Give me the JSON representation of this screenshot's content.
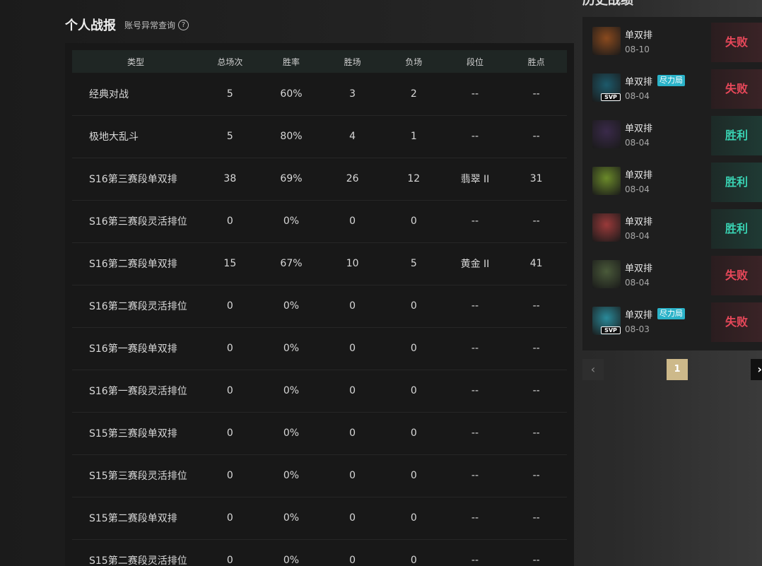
{
  "header": {
    "title": "个人战报",
    "account_query": "账号异常查询",
    "help": "?"
  },
  "table": {
    "columns": [
      "类型",
      "总场次",
      "胜率",
      "胜场",
      "负场",
      "段位",
      "胜点"
    ],
    "rows": [
      [
        "经典对战",
        "5",
        "60%",
        "3",
        "2",
        "--",
        "--"
      ],
      [
        "极地大乱斗",
        "5",
        "80%",
        "4",
        "1",
        "--",
        "--"
      ],
      [
        "S16第三赛段单双排",
        "38",
        "69%",
        "26",
        "12",
        "翡翠 II",
        "31"
      ],
      [
        "S16第三赛段灵活排位",
        "0",
        "0%",
        "0",
        "0",
        "--",
        "--"
      ],
      [
        "S16第二赛段单双排",
        "15",
        "67%",
        "10",
        "5",
        "黄金 II",
        "41"
      ],
      [
        "S16第二赛段灵活排位",
        "0",
        "0%",
        "0",
        "0",
        "--",
        "--"
      ],
      [
        "S16第一赛段单双排",
        "0",
        "0%",
        "0",
        "0",
        "--",
        "--"
      ],
      [
        "S16第一赛段灵活排位",
        "0",
        "0%",
        "0",
        "0",
        "--",
        "--"
      ],
      [
        "S15第三赛段单双排",
        "0",
        "0%",
        "0",
        "0",
        "--",
        "--"
      ],
      [
        "S15第三赛段灵活排位",
        "0",
        "0%",
        "0",
        "0",
        "--",
        "--"
      ],
      [
        "S15第二赛段单双排",
        "0",
        "0%",
        "0",
        "0",
        "--",
        "--"
      ],
      [
        "S15第二赛段灵活排位",
        "0",
        "0%",
        "0",
        "0",
        "--",
        "--"
      ]
    ]
  },
  "history": {
    "title": "历史战绩",
    "matches": [
      {
        "mode": "单双排",
        "date": "08-10",
        "tag": "",
        "svp": "",
        "result": "失败",
        "outcome": "lose",
        "avatar_color": "#8a4a1e"
      },
      {
        "mode": "单双排",
        "date": "08-04",
        "tag": "尽力局",
        "svp": "SVP",
        "result": "失败",
        "outcome": "lose",
        "avatar_color": "#1d5a6b"
      },
      {
        "mode": "单双排",
        "date": "08-04",
        "tag": "",
        "svp": "",
        "result": "胜利",
        "outcome": "win",
        "avatar_color": "#3a2a4a"
      },
      {
        "mode": "单双排",
        "date": "08-04",
        "tag": "",
        "svp": "",
        "result": "胜利",
        "outcome": "win",
        "avatar_color": "#6b8a2a"
      },
      {
        "mode": "单双排",
        "date": "08-04",
        "tag": "",
        "svp": "",
        "result": "胜利",
        "outcome": "win",
        "avatar_color": "#9a3a3a"
      },
      {
        "mode": "单双排",
        "date": "08-04",
        "tag": "",
        "svp": "",
        "result": "失败",
        "outcome": "lose",
        "avatar_color": "#4a5a3a"
      },
      {
        "mode": "单双排",
        "date": "08-03",
        "tag": "尽力局",
        "svp": "SVP",
        "result": "失败",
        "outcome": "lose",
        "avatar_color": "#2a8a9a"
      }
    ]
  },
  "pager": {
    "prev": "‹",
    "current": "1",
    "next": "›"
  }
}
